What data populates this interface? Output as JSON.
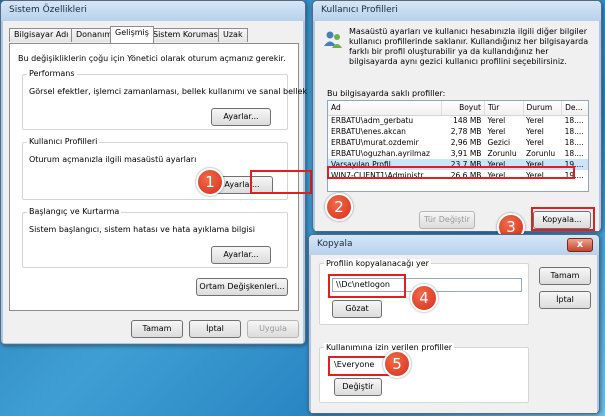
{
  "sysprops": {
    "title": "Sistem Özellikleri",
    "tabs": [
      "Bilgisayar Adı",
      "Donanım",
      "Gelişmiş",
      "Sistem Koruması",
      "Uzak"
    ],
    "admin_note": "Bu değişikliklerin çoğu için Yönetici olarak oturum açmanız gerekir.",
    "performance": {
      "title": "Performans",
      "desc": "Görsel efektler, işlemci zamanlaması, bellek kullanımı ve sanal bellek",
      "button": "Ayarlar..."
    },
    "profiles": {
      "title": "Kullanıcı Profilleri",
      "desc": "Oturum açmanızla ilgili masaüstü ayarları",
      "button": "Ayarlar..."
    },
    "startup": {
      "title": "Başlangıç ve Kurtarma",
      "desc": "Sistem başlangıcı, sistem hatası ve hata ayıklama bilgisi",
      "button": "Ayarlar..."
    },
    "env_button": "Ortam Değişkenleri...",
    "ok": "Tamam",
    "cancel": "İptal",
    "apply": "Uygula"
  },
  "userprofiles": {
    "title": "Kullanıcı Profilleri",
    "desc": "Masaüstü ayarları ve kullanıcı hesabınızla ilgili diğer bilgiler kullanıcı profillerinde saklanır. Kullandığınız her bilgisayarda farklı bir profil oluşturabilir ya da kullandığınız her bilgisayarda aynı gezici kullanıcı profilini seçebilirsiniz.",
    "list_label": "Bu bilgisayarda saklı profiller:",
    "columns": [
      "Ad",
      "Boyut",
      "Tür",
      "Durum",
      "De..."
    ],
    "rows": [
      [
        "ERBATU\\adm_gerbatu",
        "148 MB",
        "Yerel",
        "Yerel",
        "18...."
      ],
      [
        "ERBATU\\enes.akcan",
        "2,78 MB",
        "Yerel",
        "Yerel",
        "18...."
      ],
      [
        "ERBATU\\murat.ozdemir",
        "2,96 MB",
        "Gezici",
        "Yerel",
        "18...."
      ],
      [
        "ERBATU\\oguzhan.ayrilmaz",
        "3,91 MB",
        "Zorunlu",
        "Zorunlu",
        "18...."
      ],
      [
        "Varsayılan Profil",
        "23,7 MB",
        "Yerel",
        "Yerel",
        "19...."
      ],
      [
        "WIN7-CLIENT1\\Administr...",
        "26,6 MB",
        "Yerel",
        "Yerel",
        "19...."
      ]
    ],
    "change_type": "Tür Değiştir",
    "copy": "Kopyala..."
  },
  "copydlg": {
    "title": "Kopyala",
    "dest_label": "Profilin kopyalanacağı yer",
    "dest_value": "\\\\Dc\\netlogon",
    "browse": "Gözat",
    "permitted_label": "Kullanımına izin verilen profiller",
    "permitted_value": "\\Everyone",
    "change": "Değiştir",
    "ok": "Tamam",
    "cancel": "İptal",
    "close": "x"
  },
  "badges": [
    "1",
    "2",
    "3",
    "4",
    "5"
  ],
  "colors": {
    "accent_red": "#e02020",
    "badge": "#d3301b",
    "desktop": "#2a86c3"
  }
}
